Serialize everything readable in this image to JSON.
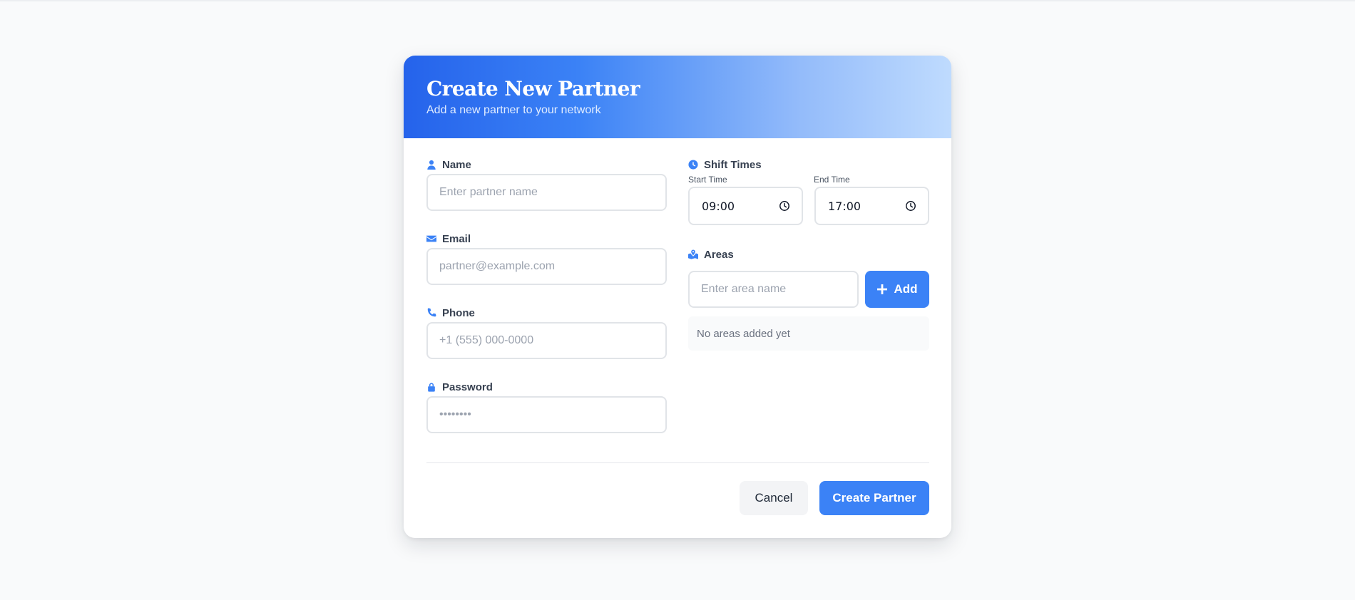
{
  "header": {
    "title": "Create New Partner",
    "subtitle": "Add a new partner to your network"
  },
  "form": {
    "name": {
      "label": "Name",
      "placeholder": "Enter partner name",
      "icon": "user-icon"
    },
    "email": {
      "label": "Email",
      "placeholder": "partner@example.com",
      "icon": "envelope-icon"
    },
    "phone": {
      "label": "Phone",
      "placeholder": "+1 (555) 000-0000",
      "icon": "phone-icon"
    },
    "password": {
      "label": "Password",
      "placeholder": "••••••••",
      "icon": "lock-icon"
    }
  },
  "shift_times": {
    "label": "Shift Times",
    "icon": "clock-icon",
    "start": {
      "label": "Start Time",
      "value": "09:00"
    },
    "end": {
      "label": "End Time",
      "value": "17:00"
    }
  },
  "areas": {
    "label": "Areas",
    "icon": "map-icon",
    "placeholder": "Enter area name",
    "add_label": "Add",
    "empty_text": "No areas added yet"
  },
  "actions": {
    "cancel_label": "Cancel",
    "submit_label": "Create Partner"
  },
  "colors": {
    "accent": "#3b82f6",
    "header_gradient_start": "#2563eb",
    "header_gradient_end": "#bfdbfe",
    "background": "#f9fafb"
  }
}
